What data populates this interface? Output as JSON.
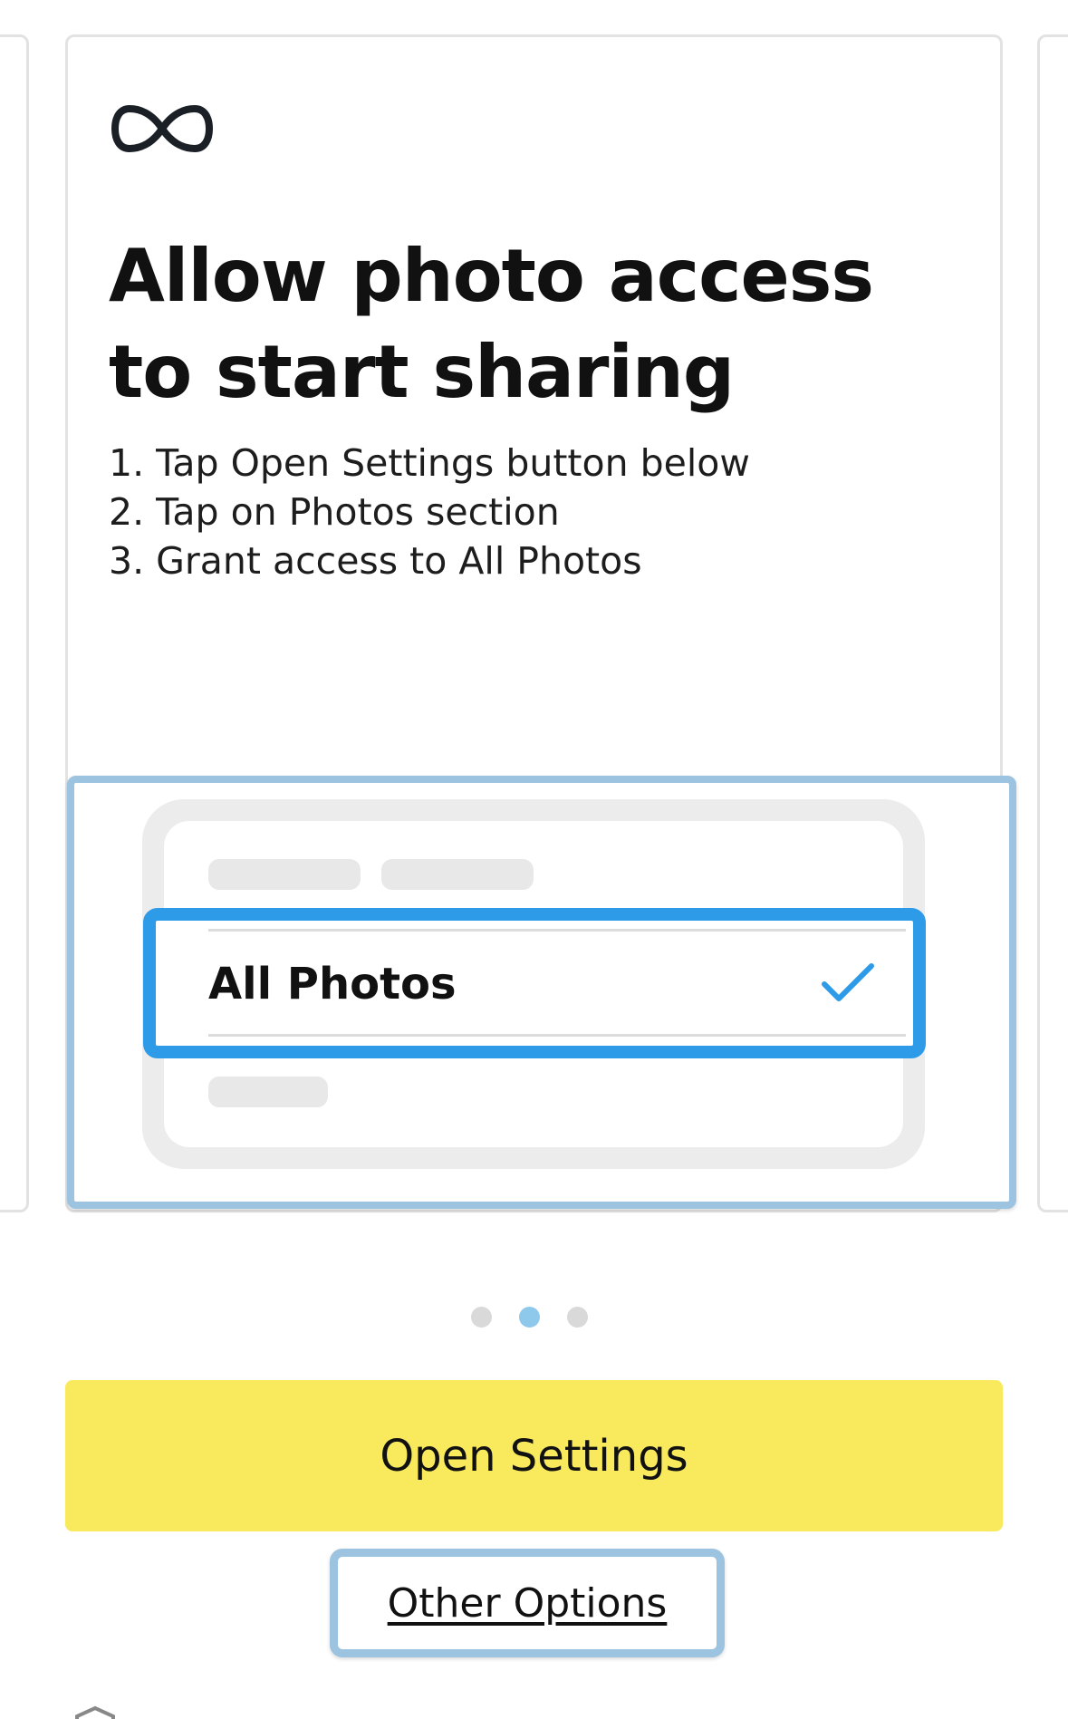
{
  "brand": {
    "icon": "infinity-icon"
  },
  "card": {
    "title": "Allow photo access to start sharing",
    "steps": [
      "1. Tap Open Settings button below",
      "2. Tap on Photos section",
      "3. Grant access to All Photos"
    ]
  },
  "illustration": {
    "option_label": "All Photos",
    "check_icon": "checkmark-icon",
    "accent_color": "#2e9be8"
  },
  "pager": {
    "total": 3,
    "active": 2
  },
  "buttons": {
    "primary_label": "Open Settings",
    "primary_color": "#f8ea5c",
    "secondary_label": "Other Options"
  },
  "footer": {
    "icon": "shield-icon"
  }
}
